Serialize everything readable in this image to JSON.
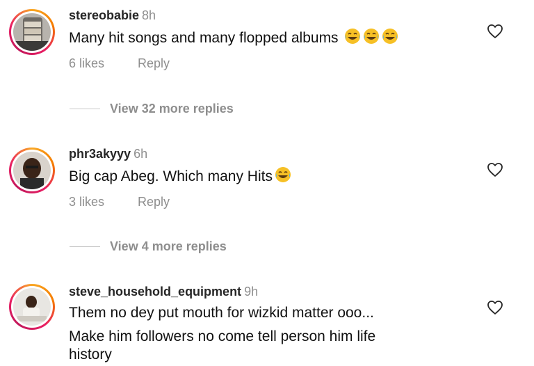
{
  "comments": [
    {
      "username": "stereobabie",
      "time": "8h",
      "text": "Many hit songs and many flopped albums",
      "emoji": [
        "face-with-tears-of-joy",
        "face-with-tears-of-joy",
        "face-with-tears-of-joy"
      ],
      "likes": "6 likes",
      "reply": "Reply",
      "view_replies": "View 32 more replies"
    },
    {
      "username": "phr3akyyy",
      "time": "6h",
      "text": "Big cap Abeg. Which many Hits",
      "emoji": [
        "face-with-tears-of-joy"
      ],
      "likes": "3 likes",
      "reply": "Reply",
      "view_replies": "View 4 more replies"
    },
    {
      "username": "steve_household_equipment",
      "time": "9h",
      "text_line1": "Them no dey put mouth for wizkid matter ooo...",
      "text_line2": "Make him followers no come tell person him life",
      "text_line3": "history"
    }
  ],
  "colors": {
    "ring": "#e91e63",
    "muted": "#8e8e8e"
  },
  "icons": {
    "like": "heart-outline-icon"
  }
}
